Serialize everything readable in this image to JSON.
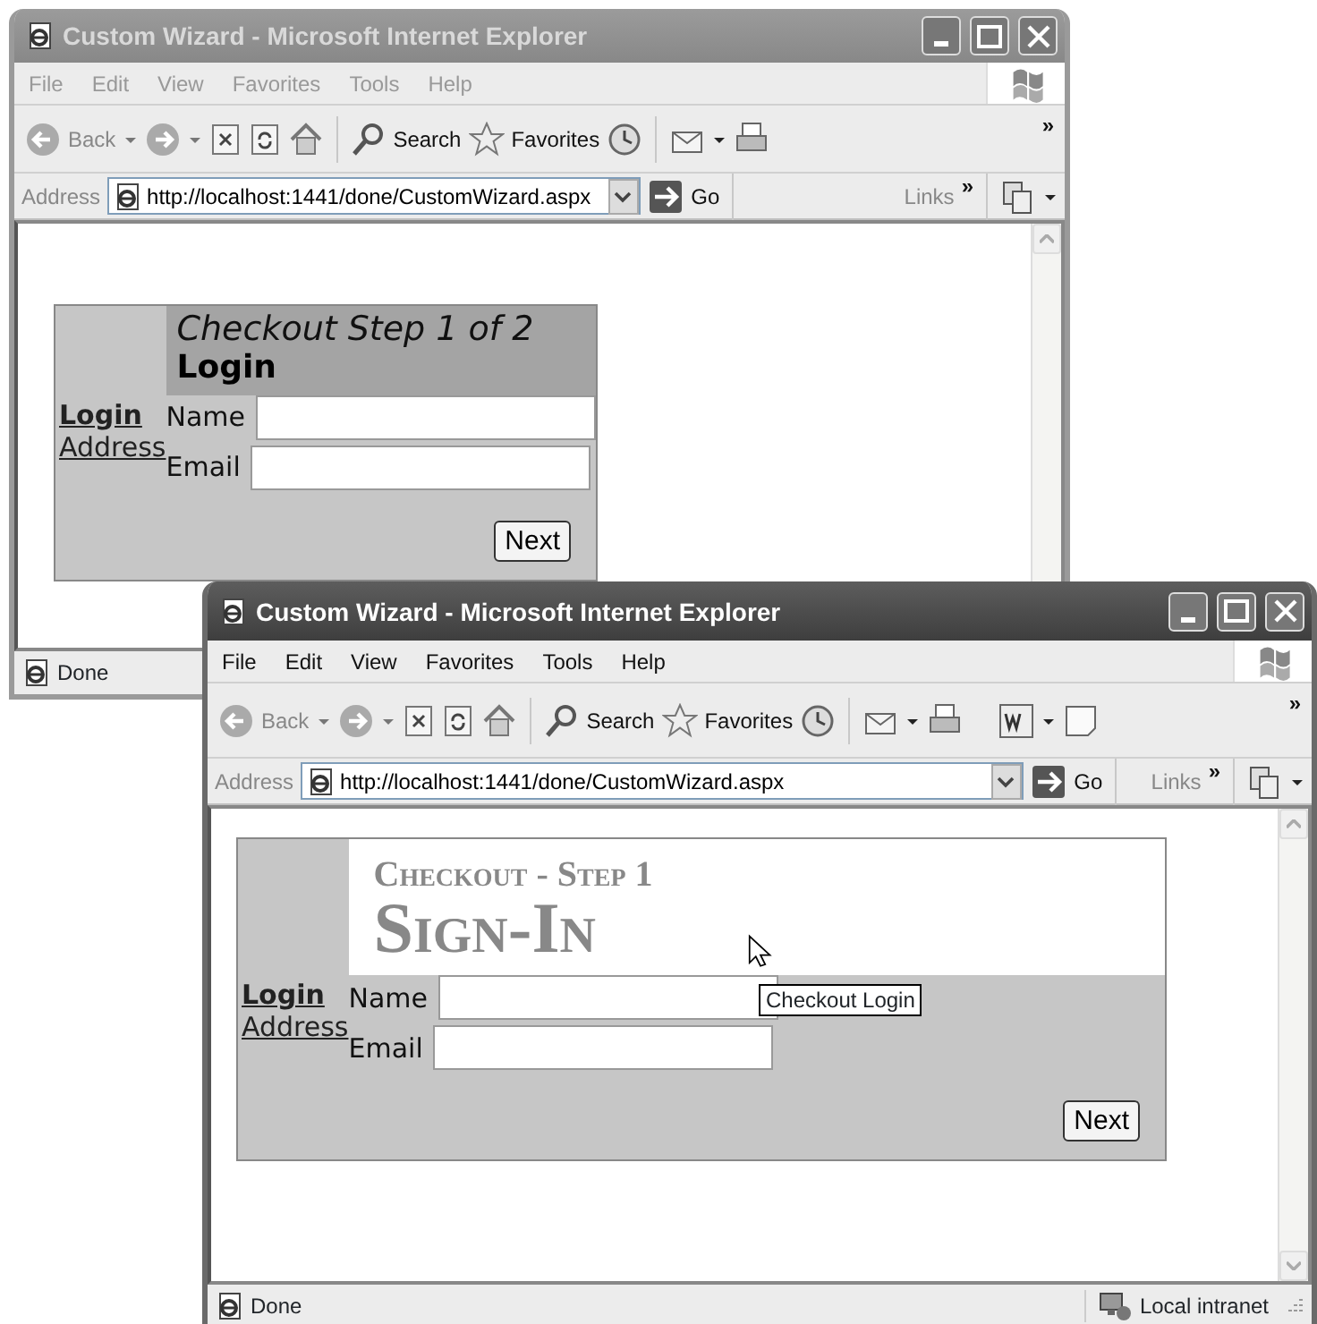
{
  "windows": [
    {
      "title": "Custom Wizard - Microsoft Internet Explorer",
      "active": false,
      "menu": [
        "File",
        "Edit",
        "View",
        "Favorites",
        "Tools",
        "Help"
      ],
      "toolbar": {
        "back": "Back",
        "search": "Search",
        "favorites": "Favorites",
        "extra_tools": false,
        "more": "»"
      },
      "address": {
        "label": "Address",
        "url": "http://localhost:1441/done/CustomWizard.aspx",
        "go": "Go",
        "links": "Links",
        "more": "»"
      },
      "page": {
        "kind": "plain",
        "subtitle": "Checkout Step 1 of 2",
        "heading": "Login",
        "steps": [
          {
            "label": "Login",
            "selected": true
          },
          {
            "label": "Address",
            "selected": false
          }
        ],
        "fields": [
          {
            "label": "Name"
          },
          {
            "label": "Email"
          }
        ],
        "button": "Next"
      },
      "status": {
        "text": "Done"
      }
    },
    {
      "title": "Custom Wizard - Microsoft Internet Explorer",
      "active": true,
      "menu": [
        "File",
        "Edit",
        "View",
        "Favorites",
        "Tools",
        "Help"
      ],
      "toolbar": {
        "back": "Back",
        "search": "Search",
        "favorites": "Favorites",
        "extra_tools": true,
        "more": "»"
      },
      "address": {
        "label": "Address",
        "url": "http://localhost:1441/done/CustomWizard.aspx",
        "go": "Go",
        "links": "Links",
        "more": "»"
      },
      "page": {
        "kind": "serif",
        "subtitle": "Checkout - Step 1",
        "heading": "Sign-In",
        "steps": [
          {
            "label": "Login",
            "selected": true
          },
          {
            "label": "Address",
            "selected": false
          }
        ],
        "fields": [
          {
            "label": "Name"
          },
          {
            "label": "Email"
          }
        ],
        "button": "Next",
        "tooltip": "Checkout Login"
      },
      "status": {
        "text": "Done",
        "zone": "Local intranet"
      }
    }
  ]
}
